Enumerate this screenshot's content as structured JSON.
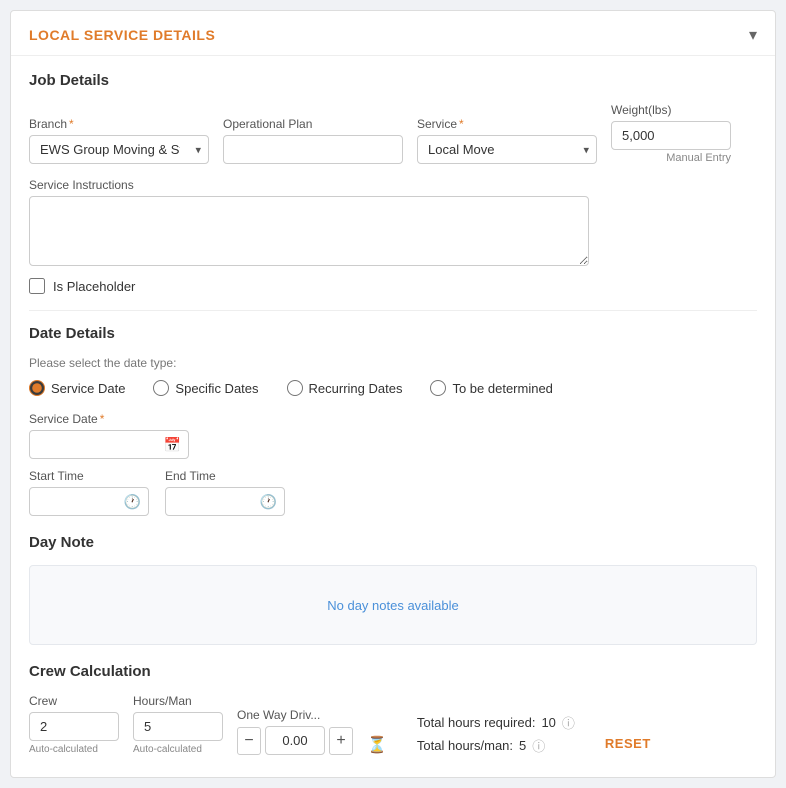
{
  "header": {
    "title": "LOCAL SERVICE DETAILS",
    "collapse_icon": "▾"
  },
  "job_details": {
    "section_label": "Job Details",
    "branch": {
      "label": "Branch",
      "required": true,
      "value": "EWS Group Moving & St...",
      "placeholder": ""
    },
    "operational_plan": {
      "label": "Operational Plan",
      "required": false,
      "value": "",
      "placeholder": ""
    },
    "service": {
      "label": "Service",
      "required": true,
      "value": "Local Move",
      "options": [
        "Local Move"
      ]
    },
    "weight": {
      "label": "Weight(lbs)",
      "value": "5,000",
      "manual_entry_label": "Manual Entry"
    }
  },
  "service_instructions": {
    "label": "Service Instructions",
    "value": ""
  },
  "is_placeholder": {
    "label": "Is Placeholder",
    "checked": false
  },
  "date_details": {
    "section_label": "Date Details",
    "date_type_prompt": "Please select the date type:",
    "date_types": [
      {
        "id": "service-date",
        "label": "Service Date",
        "selected": true
      },
      {
        "id": "specific-dates",
        "label": "Specific Dates",
        "selected": false
      },
      {
        "id": "recurring-dates",
        "label": "Recurring Dates",
        "selected": false
      },
      {
        "id": "to-be-determined",
        "label": "To be determined",
        "selected": false
      }
    ],
    "service_date_label": "Service Date",
    "service_date_required": true,
    "service_date_value": "",
    "start_time_label": "Start Time",
    "start_time_value": "",
    "end_time_label": "End Time",
    "end_time_value": ""
  },
  "day_note": {
    "section_label": "Day Note",
    "empty_message": "No day notes available"
  },
  "crew_calculation": {
    "section_label": "Crew Calculation",
    "crew_label": "Crew",
    "crew_value": "2",
    "crew_auto": "Auto-calculated",
    "hours_man_label": "Hours/Man",
    "hours_man_value": "5",
    "hours_man_auto": "Auto-calculated",
    "one_way_label": "One Way Driv...",
    "one_way_value": "0.00",
    "total_hours_label": "Total hours required:",
    "total_hours_value": "10",
    "total_hours_man_label": "Total hours/man:",
    "total_hours_man_value": "5",
    "reset_label": "RESET",
    "minus_label": "−",
    "plus_label": "+"
  }
}
